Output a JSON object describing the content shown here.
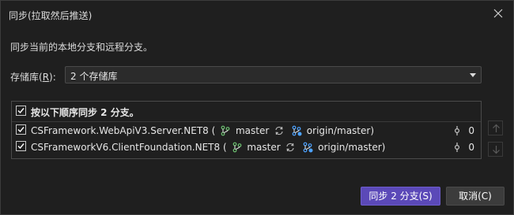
{
  "dialog": {
    "title": "同步(拉取然后推送)",
    "description": "同步当前的本地分支和远程分支。",
    "repo_label_prefix": "存储库(",
    "repo_label_key": "R",
    "repo_label_suffix": "):",
    "repo_selected": "2 个存储库"
  },
  "list": {
    "header": "按以下顺序同步 2 分支。",
    "rows": [
      {
        "name": "CSFramework.WebApiV3.Server.NET8",
        "open": "(",
        "local_branch": "master",
        "remote_branch": "origin/master)",
        "count": "0",
        "checked": true
      },
      {
        "name": "CSFrameworkV6.ClientFoundation.NET8",
        "open": "(",
        "local_branch": "master",
        "remote_branch": "origin/master)",
        "count": "0",
        "checked": true
      }
    ]
  },
  "buttons": {
    "sync": "同步 2 分支(S)",
    "cancel": "取消(C)"
  },
  "colors": {
    "accent": "#5b49b8",
    "background": "#1f1f1f",
    "branch_green": "#6cc070",
    "branch_blue": "#4da3ff"
  },
  "icons": {
    "close": "close-icon",
    "branch": "git-branch-icon",
    "remote_branch": "remote-branch-icon",
    "sync": "sync-icon",
    "commit": "commit-icon",
    "move_up": "arrow-up-icon",
    "move_down": "arrow-down-icon"
  }
}
